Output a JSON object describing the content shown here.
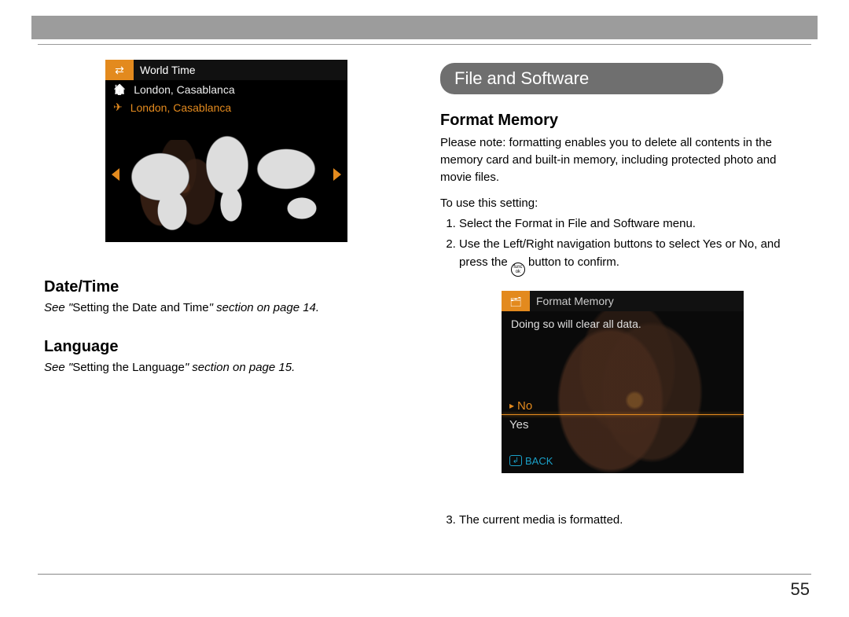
{
  "page_number": "55",
  "left_column": {
    "world_time_screenshot": {
      "title": "World Time",
      "row_home": "London, Casablanca",
      "row_away": "London, Casablanca"
    },
    "heading_datetime": "Date/Time",
    "see_datetime_prefix": "See \"",
    "see_datetime_bold": "Setting the Date and Time",
    "see_datetime_suffix": "\" section on page 14.",
    "heading_language": "Language",
    "see_language_prefix": "See \"",
    "see_language_bold": "Setting the Language",
    "see_language_suffix": "\" section on page 15."
  },
  "right_column": {
    "section_banner": "File and Software",
    "heading_format_memory": "Format Memory",
    "note_text": "Please note:  formatting enables you to delete all contents in the memory card and built-in memory, including protected photo and movie files.",
    "instr_line": "To use this setting:",
    "step1": "Select the Format in File and Software menu.",
    "step2_a": "Use the Left/Right navigation buttons to select Yes or No, and press the ",
    "step2_b": " button to confirm.",
    "func_ok_top": "func",
    "func_ok_bottom": "ok",
    "format_screenshot": {
      "title": "Format Memory",
      "warning": "Doing so will clear all data.",
      "option_no": "No",
      "option_yes": "Yes",
      "back_label": "BACK"
    },
    "step3": "The current media is formatted."
  }
}
